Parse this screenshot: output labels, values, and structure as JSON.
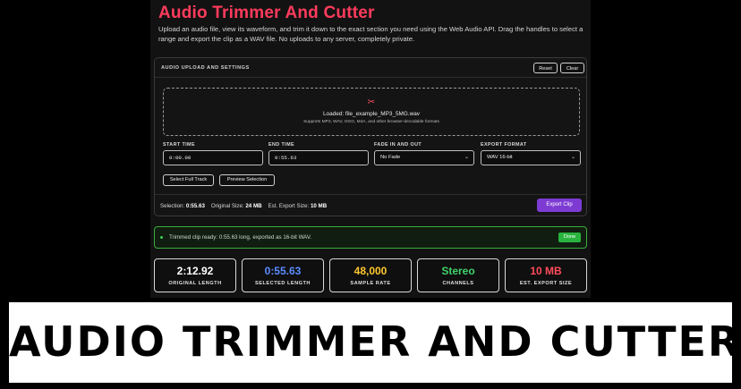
{
  "app": {
    "title": "Audio Trimmer And Cutter",
    "description": "Upload an audio file, view its waveform, and trim it down to the exact section you need using the Web Audio API. Drag the handles to select a range and export the clip as a WAV file. No uploads to any server, completely private."
  },
  "panel": {
    "title": "AUDIO UPLOAD AND SETTINGS",
    "reset_label": "Reset",
    "clear_label": "Clear",
    "dropzone": {
      "icon": "scissors-icon",
      "loaded_text": "Loaded: file_example_MP3_5MG.wav",
      "supports_text": "Supports MP3, WAV, OGG, M4A, and other browser-decodable formats"
    },
    "fields": {
      "start_label": "START TIME",
      "start_value": "0:00.00",
      "end_label": "END TIME",
      "end_value": "0:55.63",
      "fade_label": "FADE IN AND OUT",
      "fade_value": "No Fade",
      "format_label": "EXPORT FORMAT",
      "format_value": "WAV 16-bit"
    },
    "select_full_label": "Select Full Track",
    "preview_label": "Preview Selection",
    "stats": {
      "selection_label": "Selection:",
      "selection_value": "0:55.63",
      "original_label": "Original Size:",
      "original_value": "24 MB",
      "export_label": "Est. Export Size:",
      "export_value": "10 MB"
    },
    "export_button": "Export Clip"
  },
  "status": {
    "text": "Trimmed clip ready: 0:55.63 long, exported as 16-bit WAV.",
    "button": "Done"
  },
  "cards": [
    {
      "value": "2:12.92",
      "label": "ORIGINAL LENGTH",
      "color": "#ffffff"
    },
    {
      "value": "0:55.63",
      "label": "SELECTED LENGTH",
      "color": "#5b8cff"
    },
    {
      "value": "48,000",
      "label": "SAMPLE RATE",
      "color": "#ffc72e"
    },
    {
      "value": "Stereo",
      "label": "CHANNELS",
      "color": "#3fd36a"
    },
    {
      "value": "10 MB",
      "label": "EST. EXPORT SIZE",
      "color": "#ff4b5c"
    }
  ],
  "banner": {
    "text": "AUDIO TRIMMER AND CUTTER"
  },
  "colors": {
    "accent": "#ff3b5c",
    "export_button": "#7d3bd4",
    "success": "#3cae3c"
  }
}
